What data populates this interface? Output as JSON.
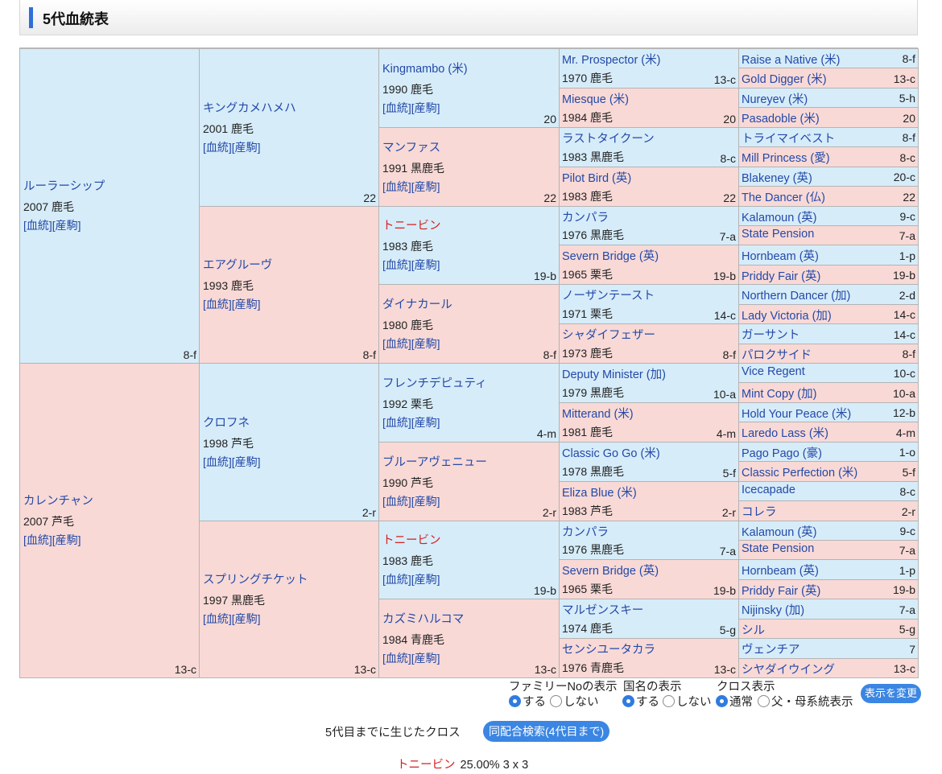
{
  "page_title": "5代血統表",
  "link_pedigree": "血統",
  "link_offspring": "産駒",
  "generations": {
    "g1": [
      {
        "name": "ルーラーシップ",
        "info": "2007 鹿毛",
        "fam": "8-f",
        "sex": "m"
      },
      {
        "name": "カレンチャン",
        "info": "2007 芦毛",
        "fam": "13-c",
        "sex": "f"
      }
    ],
    "g2": [
      {
        "name": "キングカメハメハ",
        "info": "2001 鹿毛",
        "fam": "22",
        "sex": "m"
      },
      {
        "name": "エアグルーヴ",
        "info": "1993 鹿毛",
        "fam": "8-f",
        "sex": "f"
      },
      {
        "name": "クロフネ",
        "info": "1998 芦毛",
        "fam": "2-r",
        "sex": "m"
      },
      {
        "name": "スプリングチケット",
        "info": "1997 黒鹿毛",
        "fam": "13-c",
        "sex": "f"
      }
    ],
    "g3": [
      {
        "name": "Kingmambo (米)",
        "info": "1990 鹿毛",
        "fam": "20",
        "sex": "m"
      },
      {
        "name": "マンファス",
        "info": "1991 黒鹿毛",
        "fam": "22",
        "sex": "f"
      },
      {
        "name": "トニービン",
        "info": "1983 鹿毛",
        "fam": "19-b",
        "sex": "m",
        "red": true
      },
      {
        "name": "ダイナカール",
        "info": "1980 鹿毛",
        "fam": "8-f",
        "sex": "f"
      },
      {
        "name": "フレンチデピュティ",
        "info": "1992 栗毛",
        "fam": "4-m",
        "sex": "m"
      },
      {
        "name": "ブルーアヴェニュー",
        "info": "1990 芦毛",
        "fam": "2-r",
        "sex": "f"
      },
      {
        "name": "トニービン",
        "info": "1983 鹿毛",
        "fam": "19-b",
        "sex": "m",
        "red": true
      },
      {
        "name": "カズミハルコマ",
        "info": "1984 青鹿毛",
        "fam": "13-c",
        "sex": "f"
      }
    ],
    "g4": [
      {
        "name": "Mr. Prospector (米)",
        "info": "1970 鹿毛",
        "fam": "13-c",
        "sex": "m"
      },
      {
        "name": "Miesque (米)",
        "info": "1984 鹿毛",
        "fam": "20",
        "sex": "f"
      },
      {
        "name": "ラストタイクーン",
        "info": "1983 黒鹿毛",
        "fam": "8-c",
        "sex": "m"
      },
      {
        "name": "Pilot Bird (英)",
        "info": "1983 鹿毛",
        "fam": "22",
        "sex": "f"
      },
      {
        "name": "カンパラ",
        "info": "1976 黒鹿毛",
        "fam": "7-a",
        "sex": "m"
      },
      {
        "name": "Severn Bridge (英)",
        "info": "1965 栗毛",
        "fam": "19-b",
        "sex": "f"
      },
      {
        "name": "ノーザンテースト",
        "info": "1971 栗毛",
        "fam": "14-c",
        "sex": "m"
      },
      {
        "name": "シャダイフェザー",
        "info": "1973 鹿毛",
        "fam": "8-f",
        "sex": "f"
      },
      {
        "name": "Deputy Minister (加)",
        "info": "1979 黒鹿毛",
        "fam": "10-a",
        "sex": "m"
      },
      {
        "name": "Mitterand (米)",
        "info": "1981 鹿毛",
        "fam": "4-m",
        "sex": "f"
      },
      {
        "name": "Classic Go Go (米)",
        "info": "1978 黒鹿毛",
        "fam": "5-f",
        "sex": "m"
      },
      {
        "name": "Eliza Blue (米)",
        "info": "1983 芦毛",
        "fam": "2-r",
        "sex": "f"
      },
      {
        "name": "カンパラ",
        "info": "1976 黒鹿毛",
        "fam": "7-a",
        "sex": "m"
      },
      {
        "name": "Severn Bridge (英)",
        "info": "1965 栗毛",
        "fam": "19-b",
        "sex": "f"
      },
      {
        "name": "マルゼンスキー",
        "info": "1974 鹿毛",
        "fam": "5-g",
        "sex": "m"
      },
      {
        "name": "センシユータカラ",
        "info": "1976 青鹿毛",
        "fam": "13-c",
        "sex": "f"
      }
    ],
    "g5": [
      {
        "name": "Raise a Native (米)",
        "fam": "8-f",
        "sex": "m"
      },
      {
        "name": "Gold Digger (米)",
        "fam": "13-c",
        "sex": "f"
      },
      {
        "name": "Nureyev (米)",
        "fam": "5-h",
        "sex": "m"
      },
      {
        "name": "Pasadoble (米)",
        "fam": "20",
        "sex": "f"
      },
      {
        "name": "トライマイベスト",
        "fam": "8-f",
        "sex": "m"
      },
      {
        "name": "Mill Princess (愛)",
        "fam": "8-c",
        "sex": "f"
      },
      {
        "name": "Blakeney (英)",
        "fam": "20-c",
        "sex": "m"
      },
      {
        "name": "The Dancer (仏)",
        "fam": "22",
        "sex": "f"
      },
      {
        "name": "Kalamoun (英)",
        "fam": "9-c",
        "sex": "m"
      },
      {
        "name": "State Pension",
        "fam": "7-a",
        "sex": "f"
      },
      {
        "name": "Hornbeam (英)",
        "fam": "1-p",
        "sex": "m"
      },
      {
        "name": "Priddy Fair (英)",
        "fam": "19-b",
        "sex": "f"
      },
      {
        "name": "Northern Dancer (加)",
        "fam": "2-d",
        "sex": "m"
      },
      {
        "name": "Lady Victoria (加)",
        "fam": "14-c",
        "sex": "f"
      },
      {
        "name": "ガーサント",
        "fam": "14-c",
        "sex": "m"
      },
      {
        "name": "パロクサイド",
        "fam": "8-f",
        "sex": "f"
      },
      {
        "name": "Vice Regent",
        "fam": "10-c",
        "sex": "m"
      },
      {
        "name": "Mint Copy (加)",
        "fam": "10-a",
        "sex": "f"
      },
      {
        "name": "Hold Your Peace (米)",
        "fam": "12-b",
        "sex": "m"
      },
      {
        "name": "Laredo Lass (米)",
        "fam": "4-m",
        "sex": "f"
      },
      {
        "name": "Pago Pago (豪)",
        "fam": "1-o",
        "sex": "m"
      },
      {
        "name": "Classic Perfection (米)",
        "fam": "5-f",
        "sex": "f"
      },
      {
        "name": "Icecapade",
        "fam": "8-c",
        "sex": "m"
      },
      {
        "name": "コレラ",
        "fam": "2-r",
        "sex": "f"
      },
      {
        "name": "Kalamoun (英)",
        "fam": "9-c",
        "sex": "m"
      },
      {
        "name": "State Pension",
        "fam": "7-a",
        "sex": "f"
      },
      {
        "name": "Hornbeam (英)",
        "fam": "1-p",
        "sex": "m"
      },
      {
        "name": "Priddy Fair (英)",
        "fam": "19-b",
        "sex": "f"
      },
      {
        "name": "Nijinsky (加)",
        "fam": "7-a",
        "sex": "m"
      },
      {
        "name": "シル",
        "fam": "5-g",
        "sex": "f"
      },
      {
        "name": "ヴェンチア",
        "fam": "7",
        "sex": "m"
      },
      {
        "name": "シヤダイウイング",
        "fam": "13-c",
        "sex": "f"
      }
    ]
  },
  "controls": {
    "family_label": "ファミリーNoの表示",
    "country_label": "国名の表示",
    "cross_label": "クロス表示",
    "opt_show": "する",
    "opt_hide": "しない",
    "opt_normal": "通常",
    "opt_line": "父・母系統表示",
    "change_button": "表示を変更"
  },
  "cross": {
    "title": "5代目までに生じたクロス",
    "search_button": "同配合検索(4代目まで)",
    "items": [
      {
        "name": "トニービン",
        "stat": "25.00%  3 x 3"
      }
    ]
  },
  "colors": {
    "male": "#d6ecf9",
    "female": "#f8d9d6",
    "link": "#2349a8",
    "cross_name": "#d42020",
    "accent": "#2d6fd8"
  }
}
